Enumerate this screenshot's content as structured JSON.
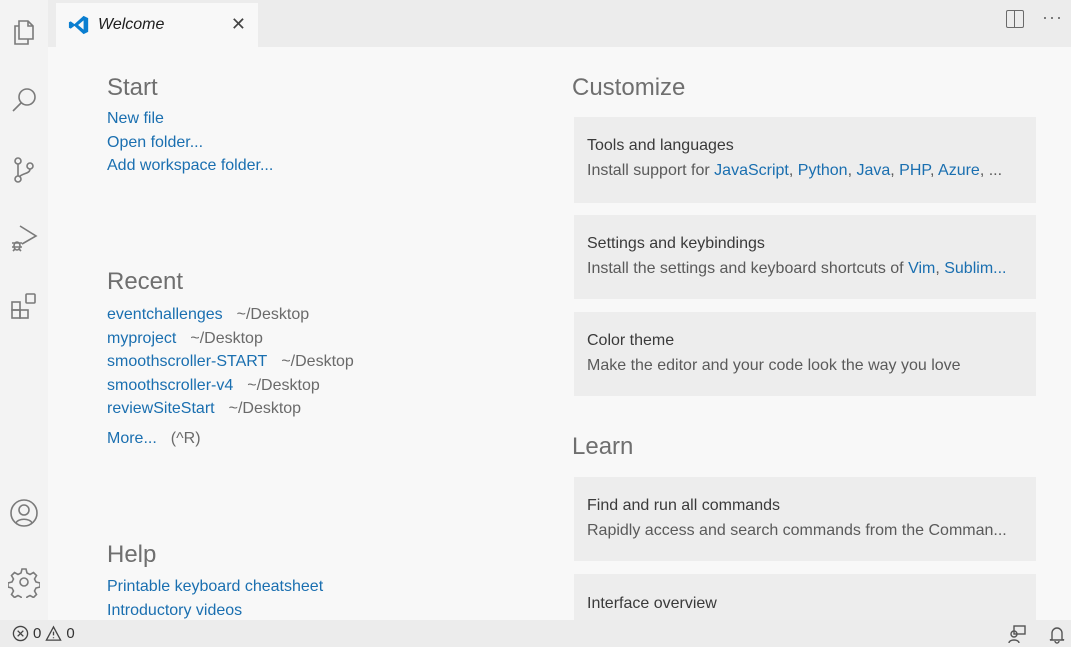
{
  "tab": {
    "title": "Welcome",
    "close_label": "✕",
    "more_label": "···"
  },
  "activity_bar": {
    "items": [
      "explorer",
      "search",
      "source-control",
      "run-and-debug",
      "extensions",
      "accounts",
      "manage"
    ]
  },
  "start": {
    "title": "Start",
    "links": [
      "New file",
      "Open folder...",
      "Add workspace folder..."
    ]
  },
  "recent": {
    "title": "Recent",
    "items": [
      {
        "name": "eventchallenges",
        "path": "~/Desktop"
      },
      {
        "name": "myproject",
        "path": "~/Desktop"
      },
      {
        "name": "smoothscroller-START",
        "path": "~/Desktop"
      },
      {
        "name": "smoothscroller-v4",
        "path": "~/Desktop"
      },
      {
        "name": "reviewSiteStart",
        "path": "~/Desktop"
      }
    ],
    "more_label": "More...",
    "more_shortcut": "(^R)"
  },
  "help": {
    "title": "Help",
    "links": [
      "Printable keyboard cheatsheet",
      "Introductory videos"
    ]
  },
  "customize": {
    "title": "Customize",
    "cards": [
      {
        "title": "Tools and languages",
        "desc_prefix": "Install support for ",
        "links": [
          "JavaScript",
          "Python",
          "Java",
          "PHP",
          "Azure"
        ],
        "desc_suffix": ", ..."
      },
      {
        "title": "Settings and keybindings",
        "desc_prefix": "Install the settings and keyboard shortcuts of ",
        "links": [
          "Vim",
          "Sublim..."
        ],
        "desc_suffix": ""
      },
      {
        "title": "Color theme",
        "desc": "Make the editor and your code look the way you love"
      }
    ]
  },
  "learn": {
    "title": "Learn",
    "cards": [
      {
        "title": "Find and run all commands",
        "desc": "Rapidly access and search commands from the Comman..."
      },
      {
        "title": "Interface overview",
        "desc": ""
      }
    ]
  },
  "status": {
    "errors": "0",
    "warnings": "0"
  },
  "colors": {
    "link": "#1a6fb0",
    "vscode_blue": "#0a7ed0",
    "background": "#f8f8f8",
    "card": "#ededed"
  }
}
